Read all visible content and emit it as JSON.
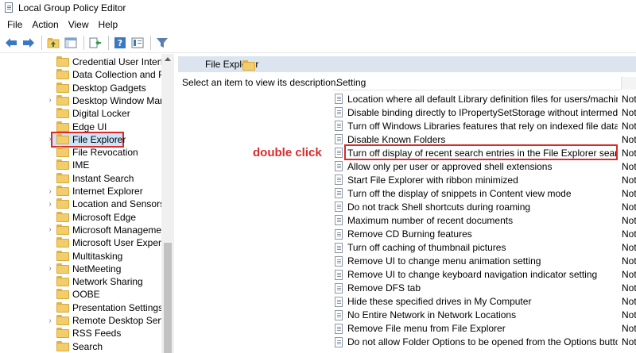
{
  "window": {
    "title": "Local Group Policy Editor"
  },
  "menu": [
    "File",
    "Action",
    "View",
    "Help"
  ],
  "toolbar": {
    "icons": [
      "back-arrow-icon",
      "forward-arrow-icon",
      "up-folder-icon",
      "show-hide-tree-icon",
      "export-list-icon",
      "help-icon",
      "properties-icon",
      "filter-icon"
    ]
  },
  "tree": {
    "items": [
      {
        "label": "Credential User Interfac",
        "expandable": false
      },
      {
        "label": "Data Collection and Pre",
        "expandable": false
      },
      {
        "label": "Desktop Gadgets",
        "expandable": false
      },
      {
        "label": "Desktop Window Mana",
        "expandable": true
      },
      {
        "label": "Digital Locker",
        "expandable": false
      },
      {
        "label": "Edge UI",
        "expandable": false
      },
      {
        "label": "File Explorer",
        "expandable": true,
        "selected": true
      },
      {
        "label": "File Revocation",
        "expandable": false
      },
      {
        "label": "IME",
        "expandable": false
      },
      {
        "label": "Instant Search",
        "expandable": false
      },
      {
        "label": "Internet Explorer",
        "expandable": true
      },
      {
        "label": "Location and Sensors",
        "expandable": true
      },
      {
        "label": "Microsoft Edge",
        "expandable": false
      },
      {
        "label": "Microsoft Management",
        "expandable": true
      },
      {
        "label": "Microsoft User Experier",
        "expandable": false
      },
      {
        "label": "Multitasking",
        "expandable": false
      },
      {
        "label": "NetMeeting",
        "expandable": true
      },
      {
        "label": "Network Sharing",
        "expandable": false
      },
      {
        "label": "OOBE",
        "expandable": false
      },
      {
        "label": "Presentation Settings",
        "expandable": false
      },
      {
        "label": "Remote Desktop Servic",
        "expandable": true
      },
      {
        "label": "RSS Feeds",
        "expandable": false
      },
      {
        "label": "Search",
        "expandable": false
      }
    ]
  },
  "right_pane": {
    "header": "File Explorer",
    "description": "Select an item to view its description.",
    "column_setting": "Setting",
    "annotation": "double click",
    "settings": [
      {
        "label": "Location where all default Library definition files for users/machines ...",
        "state": "Not"
      },
      {
        "label": "Disable binding directly to IPropertySetStorage without intermediate...",
        "state": "Not"
      },
      {
        "label": "Turn off Windows Libraries features that rely on indexed file data",
        "state": "Not"
      },
      {
        "label": "Disable Known Folders",
        "state": "Not"
      },
      {
        "label": "Turn off display of recent search entries in the File Explorer search box",
        "state": "Not",
        "highlighted": true
      },
      {
        "label": "Allow only per user or approved shell extensions",
        "state": "Not"
      },
      {
        "label": "Start File Explorer with ribbon minimized",
        "state": "Not"
      },
      {
        "label": "Turn off the display of snippets in Content view mode",
        "state": "Not"
      },
      {
        "label": "Do not track Shell shortcuts during roaming",
        "state": "Not"
      },
      {
        "label": "Maximum number of recent documents",
        "state": "Not"
      },
      {
        "label": "Remove CD Burning features",
        "state": "Not"
      },
      {
        "label": "Turn off caching of thumbnail pictures",
        "state": "Not"
      },
      {
        "label": "Remove UI to change menu animation setting",
        "state": "Not"
      },
      {
        "label": "Remove UI to change keyboard navigation indicator setting",
        "state": "Not"
      },
      {
        "label": "Remove DFS tab",
        "state": "Not"
      },
      {
        "label": "Hide these specified drives in My Computer",
        "state": "Not"
      },
      {
        "label": "No Entire Network in Network Locations",
        "state": "Not"
      },
      {
        "label": "Remove File menu from File Explorer",
        "state": "Not"
      },
      {
        "label": "Do not allow Folder Options to be opened from the Options button ...",
        "state": "Not"
      }
    ]
  },
  "colors": {
    "highlight_red": "#d92b2b",
    "selection_blue": "#cce4f7",
    "header_blue": "#dbe4ef"
  }
}
